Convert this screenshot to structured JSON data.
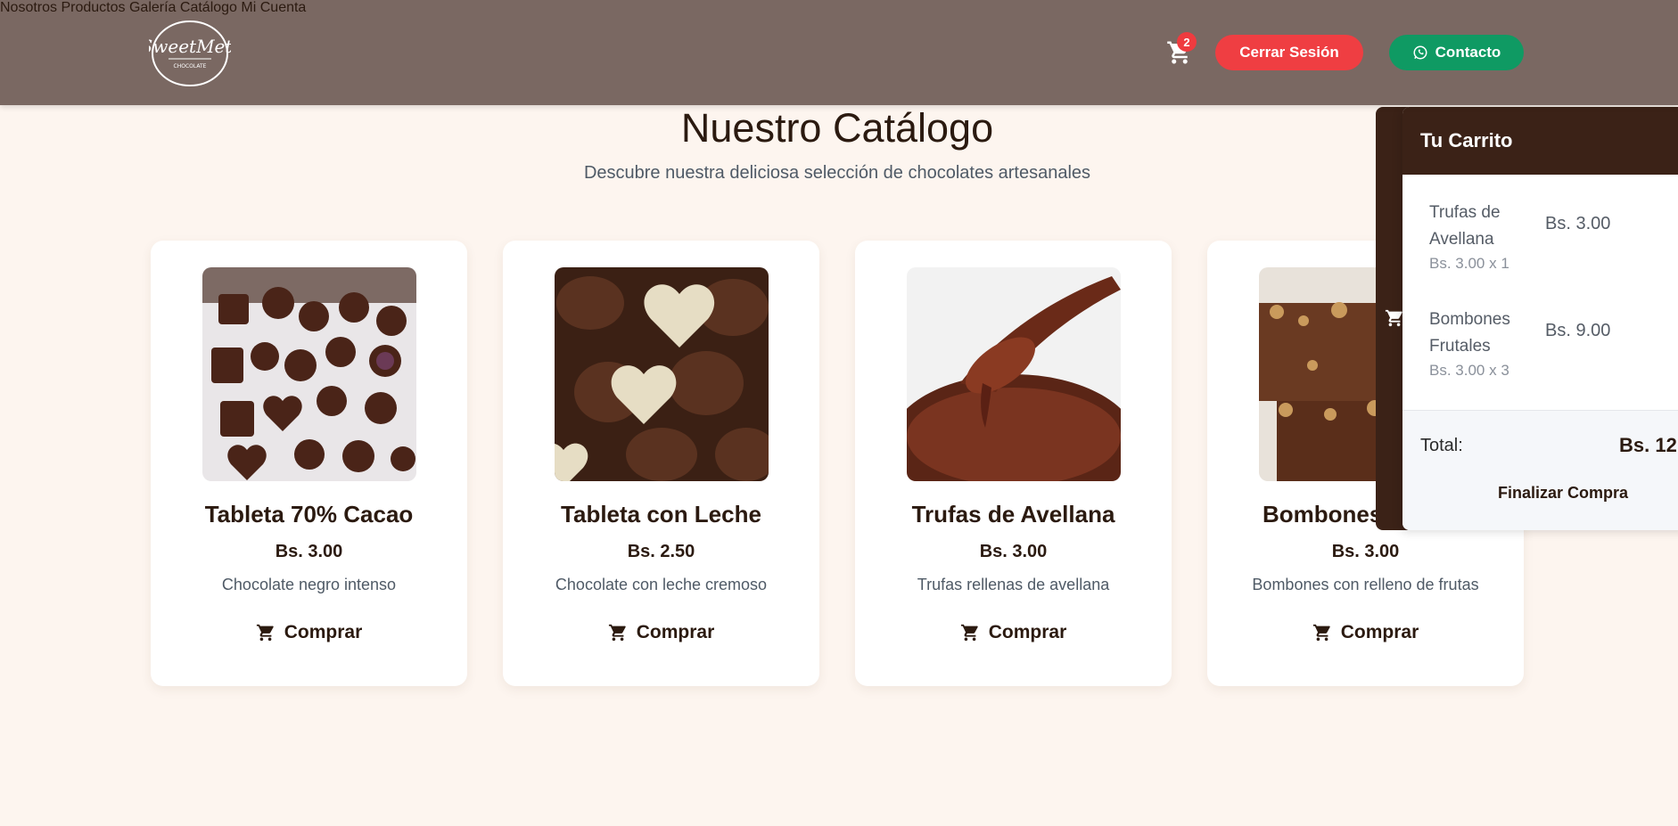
{
  "header": {
    "logo_text": "SweetMett",
    "logo_sub": "CHOCOLATE",
    "nav": [
      "Nosotros",
      "Productos",
      "Galería",
      "Catálogo",
      "Mi Cuenta"
    ],
    "cart_count": "2",
    "logout_label": "Cerrar Sesión",
    "contact_label": "Contacto"
  },
  "main": {
    "title": "Nuestro Catálogo",
    "subtitle": "Descubre nuestra deliciosa selección de chocolates artesanales",
    "products": [
      {
        "name": "Tableta 70% Cacao",
        "price": "Bs. 3.00",
        "desc": "Chocolate negro intenso",
        "buy": "Comprar"
      },
      {
        "name": "Tableta con Leche",
        "price": "Bs. 2.50",
        "desc": "Chocolate con leche cremoso",
        "buy": "Comprar"
      },
      {
        "name": "Trufas de Avellana",
        "price": "Bs. 3.00",
        "desc": "Trufas rellenas de avellana",
        "buy": "Comprar"
      },
      {
        "name": "Bombones",
        "price": "Bs. 3.00",
        "desc": "Bombones con relleno de frutas",
        "buy": "Comprar"
      }
    ]
  },
  "cart": {
    "title": "Tu Carrito",
    "items": [
      {
        "name": "Trufas de Avellana",
        "qty": "Bs. 3.00 x 1",
        "total": "Bs. 3.00"
      },
      {
        "name": "Bombones Frutales",
        "qty": "Bs. 3.00 x 3",
        "total": "Bs. 9.00"
      }
    ],
    "total_label": "Total:",
    "total_value": "Bs. 12",
    "checkout_label": "Finalizar Compra"
  },
  "colors": {
    "header_bg": "#7a6862",
    "page_bg": "#fdf5ef",
    "logout": "#ef3e42",
    "contact": "#0f9a63",
    "cart_dark": "#3b2217"
  }
}
